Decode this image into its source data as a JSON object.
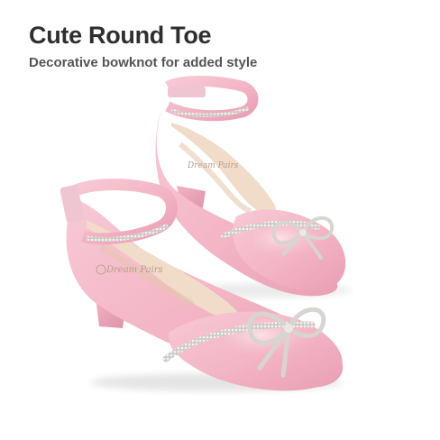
{
  "header": {
    "title": "Cute Round Toe",
    "subtitle": "Decorative bowknot for added style"
  },
  "product": {
    "brand_mark": "Dream Pairs",
    "shoe_color": "#f4b8c8",
    "insole_color": "#f1dcc9",
    "rhinestone_color": "#d9d6d2"
  }
}
